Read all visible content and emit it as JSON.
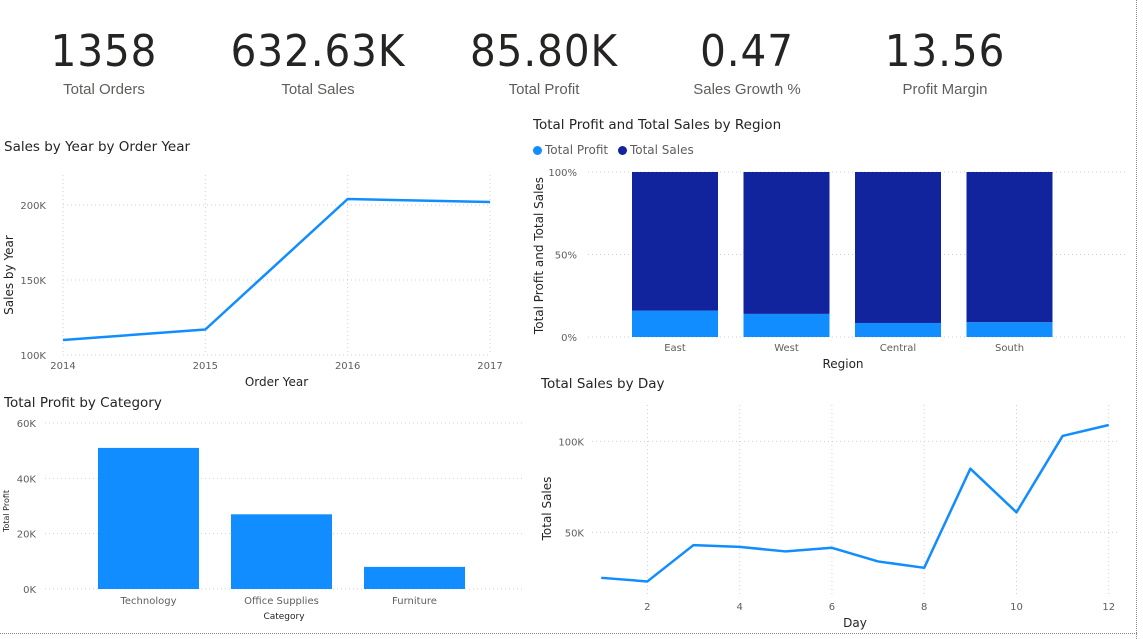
{
  "kpis": [
    {
      "value": "1358",
      "label": "Total Orders"
    },
    {
      "value": "632.63K",
      "label": "Total Sales"
    },
    {
      "value": "85.80K",
      "label": "Total Profit"
    },
    {
      "value": "0.47",
      "label": "Sales Growth %"
    },
    {
      "value": "13.56",
      "label": "Profit Margin"
    }
  ],
  "colors": {
    "light_blue": "#118dff",
    "dark_blue": "#12239e"
  },
  "chart_data": [
    {
      "id": "sales_by_year",
      "type": "line",
      "title": "Sales by Year by Order Year",
      "xlabel": "Order Year",
      "ylabel": "Sales by Year",
      "x": [
        2014,
        2015,
        2016,
        2017
      ],
      "x_tick_labels": [
        "2014",
        "2015",
        "2016",
        "2017"
      ],
      "series": [
        {
          "values": [
            110000,
            117000,
            204000,
            202000
          ]
        }
      ],
      "ylim": [
        100000,
        220000
      ],
      "y_ticks": [
        100000,
        150000,
        200000
      ],
      "y_tick_labels": [
        "100K",
        "150K",
        "200K"
      ],
      "grid": true
    },
    {
      "id": "profit_sales_by_region",
      "type": "bar",
      "stacked": "100%",
      "title": "Total Profit and Total Sales by Region",
      "xlabel": "Region",
      "ylabel": "Total Profit and Total Sales",
      "categories": [
        "East",
        "West",
        "Central",
        "South"
      ],
      "series": [
        {
          "name": "Total Profit",
          "values": [
            16,
            14,
            8.5,
            9
          ],
          "color": "#118dff"
        },
        {
          "name": "Total Sales",
          "values": [
            84,
            86,
            91.5,
            91
          ],
          "color": "#12239e"
        }
      ],
      "y_ticks": [
        0,
        50,
        100
      ],
      "y_tick_labels": [
        "0%",
        "50%",
        "100%"
      ],
      "legend": "top-left"
    },
    {
      "id": "profit_by_category",
      "type": "bar",
      "title": "Total Profit by Category",
      "xlabel": "Category",
      "ylabel": "Total Profit",
      "categories": [
        "Technology",
        "Office Supplies",
        "Furniture"
      ],
      "values": [
        51000,
        27000,
        8000
      ],
      "ylim": [
        0,
        60000
      ],
      "y_ticks": [
        0,
        20000,
        40000,
        60000
      ],
      "y_tick_labels": [
        "0K",
        "20K",
        "40K",
        "60K"
      ],
      "color": "#118dff",
      "grid": true
    },
    {
      "id": "sales_by_day",
      "type": "line",
      "title": "Total Sales by Day",
      "xlabel": "Day",
      "ylabel": "Total Sales",
      "x": [
        1,
        2,
        3,
        4,
        5,
        6,
        7,
        8,
        9,
        10,
        11,
        12
      ],
      "x_ticks": [
        2,
        4,
        6,
        8,
        10,
        12
      ],
      "x_tick_labels": [
        "2",
        "4",
        "6",
        "8",
        "10",
        "12"
      ],
      "series": [
        {
          "values": [
            25000,
            23000,
            43000,
            42000,
            39500,
            41500,
            34000,
            30500,
            85000,
            61000,
            103000,
            109000
          ]
        }
      ],
      "ylim": [
        15000,
        120000
      ],
      "y_ticks": [
        50000,
        100000
      ],
      "y_tick_labels": [
        "50K",
        "100K"
      ],
      "grid": true
    }
  ]
}
